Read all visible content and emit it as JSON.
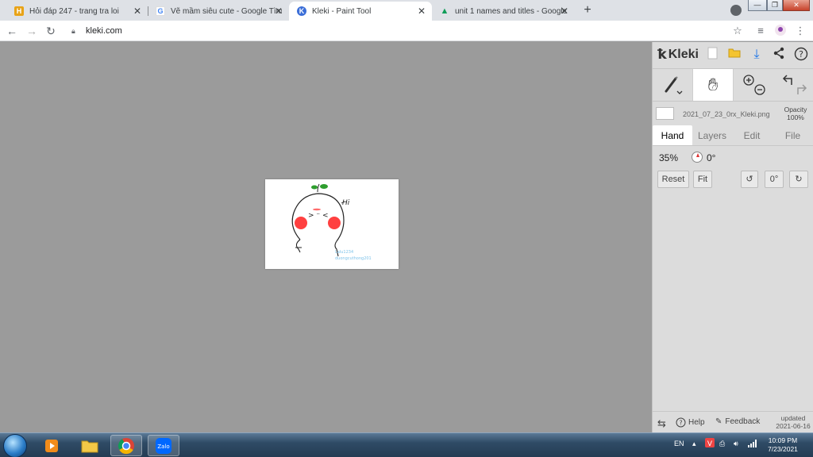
{
  "browser": {
    "tabs": [
      {
        "title": "Hỏi đáp 247 - trang tra loi",
        "favicon": "h-logo-icon",
        "fav_letter": "H",
        "fav_color": "#e8a317"
      },
      {
        "title": "Vẽ mầm siêu cute - Google Tìm k",
        "favicon": "google-icon",
        "fav_letter": "G",
        "fav_color": "#4285f4"
      },
      {
        "title": "Kleki - Paint Tool",
        "favicon": "kleki-icon",
        "fav_letter": "K",
        "fav_color": "#3b6ed8"
      },
      {
        "title": "unit 1 names and titles - Google",
        "favicon": "drive-icon",
        "fav_letter": "▲",
        "fav_color": "#0f9d58"
      }
    ],
    "new_tab": "+",
    "url": "kleki.com"
  },
  "kleki": {
    "brand": "Kleki",
    "file_name": "2021_07_23_0rx_Kleki.png",
    "opacity_label": "Opacity",
    "opacity_value": "100%",
    "tabs": [
      "Hand",
      "Layers",
      "Edit",
      "File"
    ],
    "zoom": "35%",
    "rotation": "0°",
    "reset_label": "Reset",
    "fit_label": "Fit",
    "rot_value": "0°",
    "help_label": "Help",
    "feedback_label": "Feedback",
    "updated_label": "updated",
    "updated_date": "2021-06-16"
  },
  "drawing": {
    "sprout_colors": [
      "#2e9e2e"
    ],
    "cheek_color": "#ff2b2b",
    "text_hi": "Hi",
    "signature": "Lalu1234 duongcuthong201"
  },
  "taskbar": {
    "lang": "EN",
    "time": "10:09 PM",
    "date": "7/23/2021",
    "apps": [
      "media-player-icon",
      "file-explorer-icon",
      "chrome-icon",
      "zalo-icon"
    ],
    "zalo_label": "Zalo"
  }
}
